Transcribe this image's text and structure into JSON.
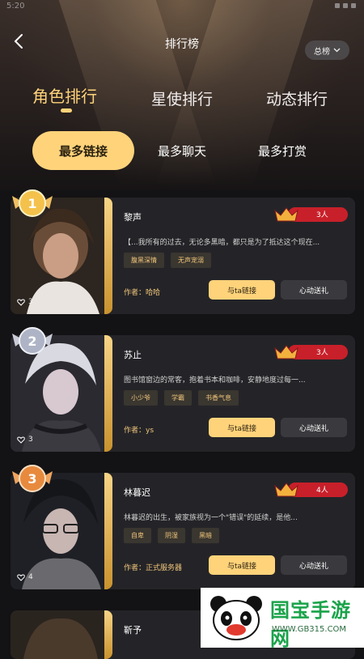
{
  "status_time": "5:20",
  "header": {
    "title": "排行榜",
    "dropdown_label": "总榜"
  },
  "tabs": [
    {
      "label": "角色排行",
      "active": true
    },
    {
      "label": "星使排行",
      "active": false
    },
    {
      "label": "动态排行",
      "active": false
    }
  ],
  "subtabs": [
    {
      "label": "最多链接",
      "active": true
    },
    {
      "label": "最多聊天",
      "active": false
    },
    {
      "label": "最多打赏",
      "active": false
    }
  ],
  "cards": [
    {
      "rank": "1",
      "name": "黎声",
      "count": "3人",
      "likes": "3",
      "desc": "【...我所有的过去，无论多黑暗，都只是为了抵达这个现在...",
      "tags": [
        "腹黑深情",
        "无声宠溺"
      ],
      "author": "作者：哈哈",
      "link_label": "与ta链接",
      "gift_label": "心动送礼"
    },
    {
      "rank": "2",
      "name": "苏止",
      "count": "3人",
      "likes": "3",
      "desc": "图书馆窗边的常客，抱着书本和咖啡，安静地度过每一...",
      "tags": [
        "小少爷",
        "学霸",
        "书香气息"
      ],
      "author": "作者：ys",
      "link_label": "与ta链接",
      "gift_label": "心动送礼"
    },
    {
      "rank": "3",
      "name": "林暮迟",
      "count": "4人",
      "likes": "4",
      "desc": "林暮迟的出生，被家族视为一个\"错误\"的延续，是他...",
      "tags": [
        "自卑",
        "阴湿",
        "黑暗"
      ],
      "author": "作者：正式服务器",
      "link_label": "与ta链接",
      "gift_label": "心动送礼"
    },
    {
      "name": "靳予"
    }
  ],
  "watermark": {
    "text": "国宝手游网",
    "url": "WWW.GB315.COM"
  },
  "colors": {
    "accent": "#ffd37a",
    "card": "#242428",
    "bg": "#131214"
  }
}
